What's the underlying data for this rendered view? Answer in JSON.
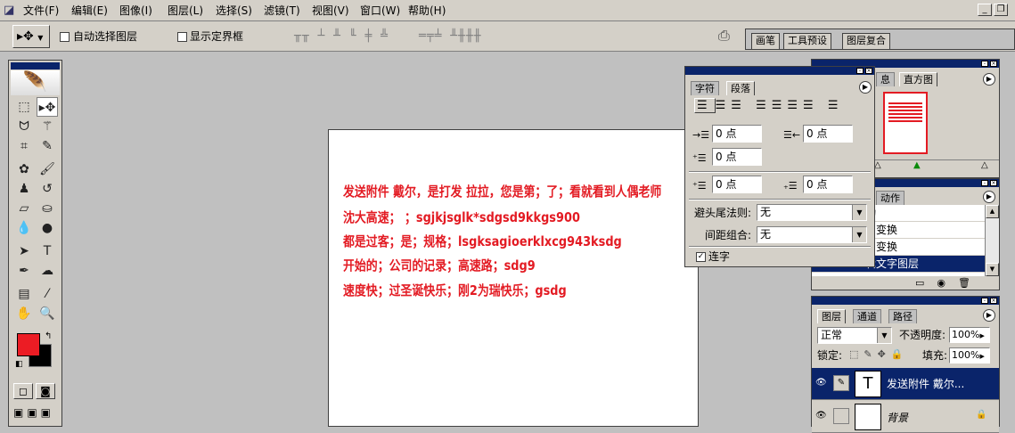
{
  "menubar": {
    "items": [
      "文件(F)",
      "编辑(E)",
      "图像(I)",
      "图层(L)",
      "选择(S)",
      "滤镜(T)",
      "视图(V)",
      "窗口(W)",
      "帮助(H)"
    ]
  },
  "options": {
    "auto_select": "自动选择图层",
    "show_bounds": "显示定界框",
    "workspace_tabs": [
      "画笔",
      "工具预设",
      "图层复合"
    ]
  },
  "canvas": {
    "text_color": "#e31b23",
    "lines": [
      "发送附件 戴尔，是打发 拉拉，您是第；了；看就看到人偶老师",
      "沈大高速；  ；sgjkjsglk*sdgsd9kkgs900",
      "都是过客；是；规格；lsgksagioerklxcg943ksdg",
      "开始的；公司的记录；高速路；sdg9",
      "速度快；过圣诞快乐；刚2为瑞快乐；gsdg"
    ]
  },
  "char_panel": {
    "tabs": [
      "字符",
      "段落"
    ],
    "indent_left": "0 点",
    "indent_right": "0 点",
    "indent_first": "0 点",
    "space_before": "0 点",
    "space_after": "0 点",
    "kinsoku_label": "避头尾法则:",
    "kinsoku_value": "无",
    "mojikumi_label": "间距组合:",
    "mojikumi_value": "无",
    "hyphen_label": "连字"
  },
  "nav_panel": {
    "tabs": [
      "息",
      "直方图"
    ]
  },
  "history_panel": {
    "tab": "动作",
    "rows": [
      "动",
      "由变换",
      "由变换",
      "辑文字图层"
    ]
  },
  "layers_panel": {
    "tabs": [
      "图层",
      "通道",
      "路径"
    ],
    "blend_mode": "正常",
    "opacity_label": "不透明度:",
    "opacity_value": "100%",
    "lock_label": "锁定:",
    "fill_label": "填充:",
    "fill_value": "100%",
    "layers": [
      {
        "name": "发送附件 戴尔...",
        "thumb": "T"
      },
      {
        "name": "背景",
        "thumb": ""
      }
    ]
  },
  "colors": {
    "foreground": "#ec1c24",
    "background": "#000000",
    "accent": "#0a246a"
  }
}
